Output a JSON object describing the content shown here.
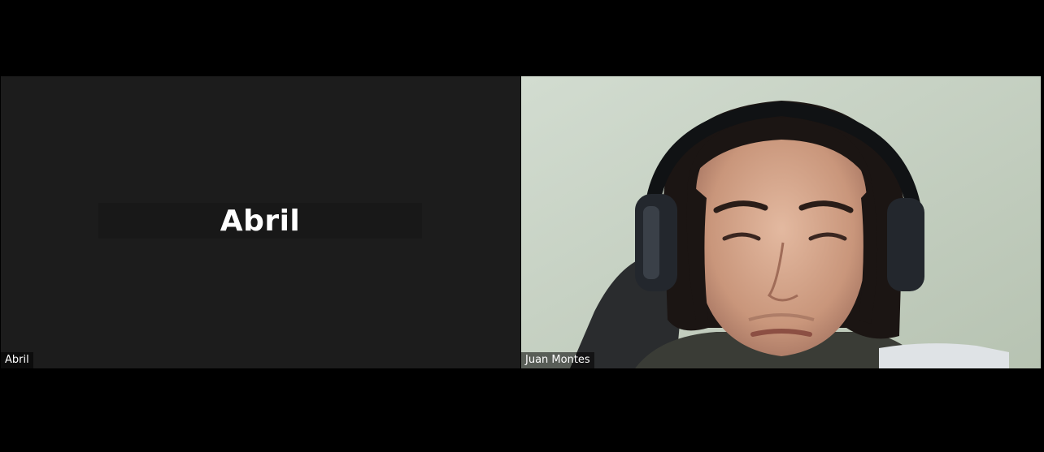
{
  "participants": [
    {
      "id": "abril",
      "display_name": "Abril",
      "name_tag": "Abril",
      "video_on": false
    },
    {
      "id": "juan",
      "display_name": "Juan Montes",
      "name_tag": "Juan Montes",
      "video_on": true
    }
  ],
  "colors": {
    "background": "#000000",
    "tile_off": "#1c1c1c",
    "wall": "#c9d3c4"
  }
}
